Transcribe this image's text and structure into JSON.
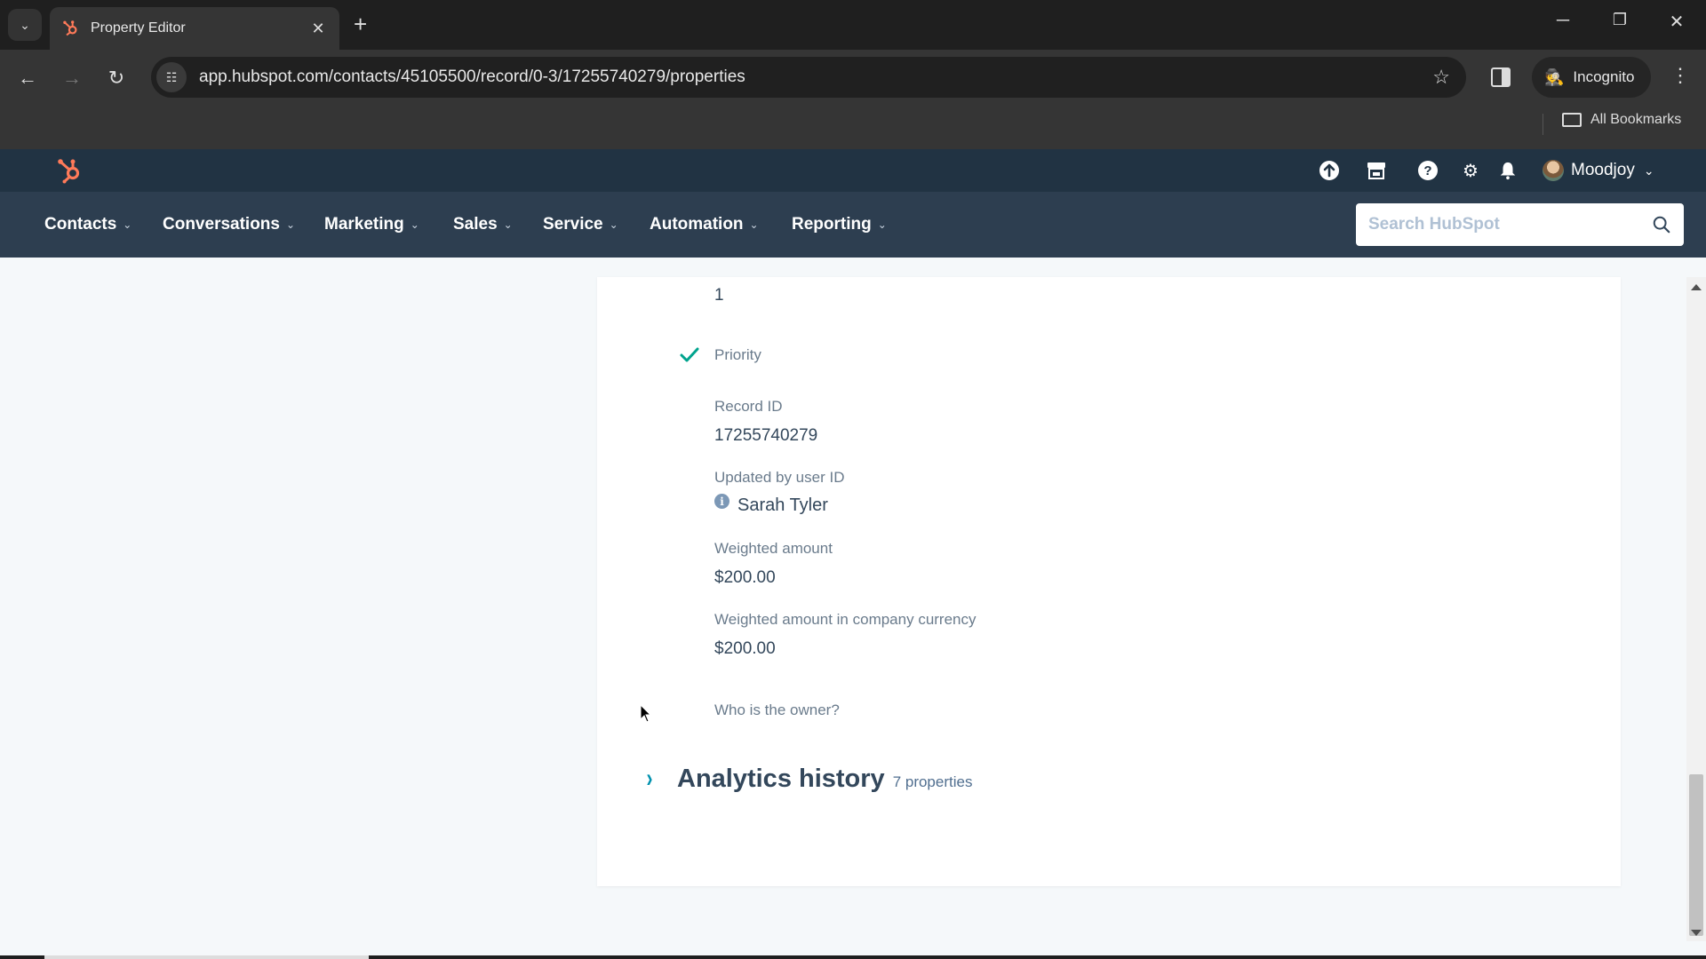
{
  "browser": {
    "tab_title": "Property Editor",
    "url": "app.hubspot.com/contacts/45105500/record/0-3/17255740279/properties",
    "profile_label": "Incognito",
    "bookmarks_label": "All Bookmarks",
    "icons": {
      "tab_search": "chevron-down-icon",
      "new_tab": "plus-icon",
      "back": "arrow-left-icon",
      "forward": "arrow-right-icon",
      "reload": "reload-icon",
      "site_info": "tune-icon",
      "bookmark": "star-icon",
      "side_panel": "side-panel-icon",
      "menu": "kebab-icon"
    },
    "glyphs": {
      "tab_search": "⌄",
      "close": "✕",
      "new_tab": "+",
      "back": "←",
      "forward": "→",
      "reload": "↻",
      "site_info": "☷",
      "star": "☆",
      "incognito": "🕵",
      "kebab": "⋮",
      "minimize": "─",
      "restore": "❐",
      "win_close": "✕"
    }
  },
  "hubspot": {
    "brand_color": "#ff7a59",
    "topbar_icons": [
      "upgrade-icon",
      "marketplace-icon",
      "help-icon",
      "settings-icon",
      "notifications-icon"
    ],
    "topbar_glyphs": {
      "upgrade": "⬆",
      "marketplace": "▦",
      "help": "?",
      "settings": "⚙",
      "notifications": "🔔"
    },
    "user_name": "Moodjoy",
    "nav": [
      {
        "label": "Contacts"
      },
      {
        "label": "Conversations"
      },
      {
        "label": "Marketing"
      },
      {
        "label": "Sales"
      },
      {
        "label": "Service"
      },
      {
        "label": "Automation"
      },
      {
        "label": "Reporting"
      }
    ],
    "nav_chevron": "⌄",
    "search_placeholder": "Search HubSpot"
  },
  "record": {
    "top_value": "1",
    "priority_label": "Priority",
    "properties": [
      {
        "label": "Record ID",
        "value": "17255740279"
      },
      {
        "label": "Updated by user ID",
        "value": "Sarah Tyler"
      },
      {
        "label": "Weighted amount",
        "value": "$200.00"
      },
      {
        "label": "Weighted amount in company currency",
        "value": "$200.00"
      },
      {
        "label": "Who is the owner?",
        "value": ""
      }
    ],
    "info_glyph": "i",
    "section": {
      "chevron": "›",
      "title": "Analytics history",
      "count": "7 properties"
    },
    "accent_color": "#0091ae",
    "check_color": "#00bda5"
  }
}
